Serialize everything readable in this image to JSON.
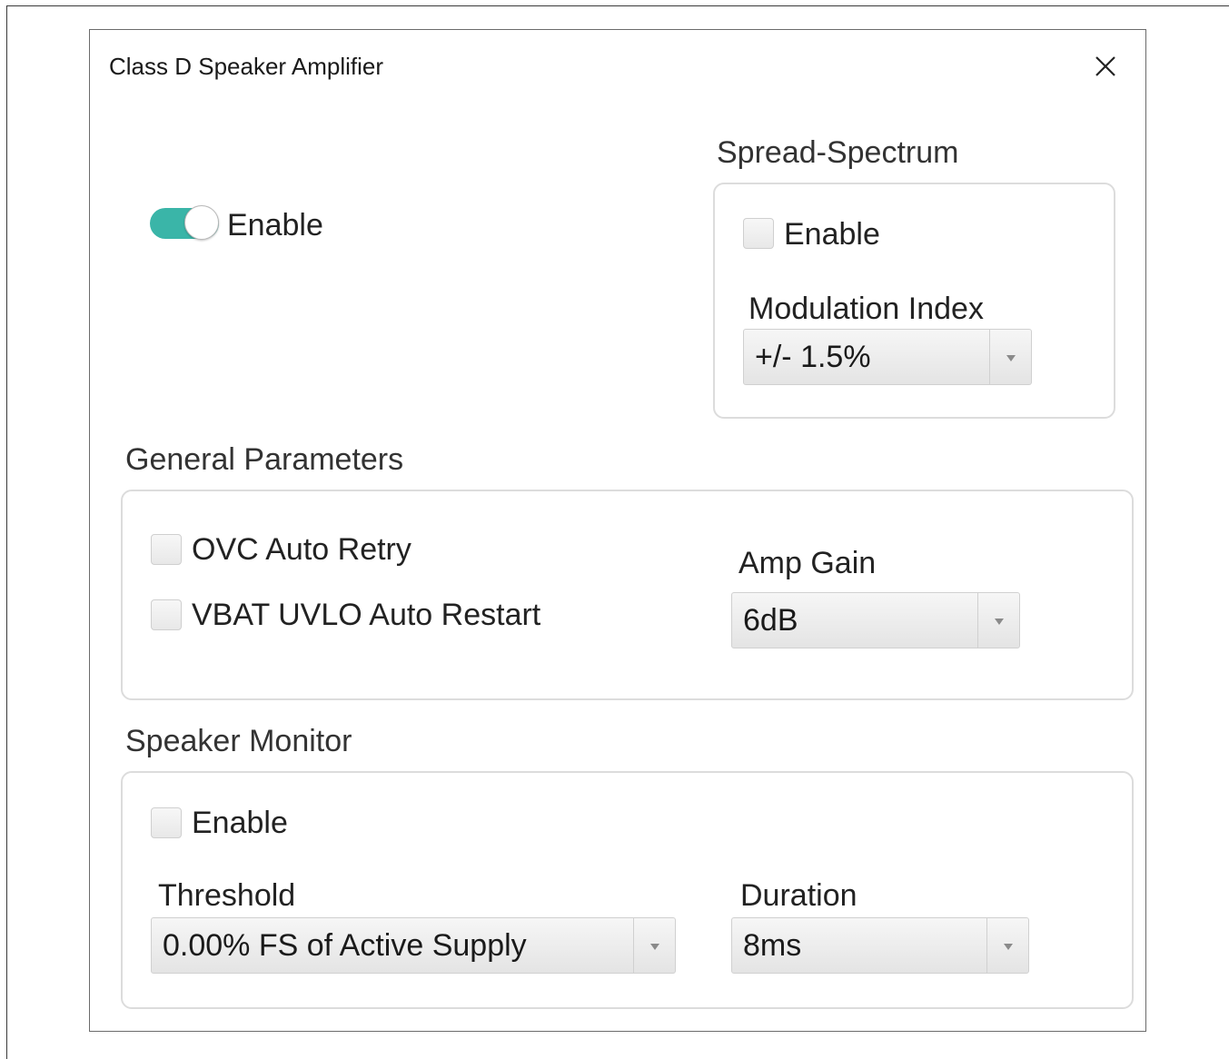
{
  "window": {
    "title": "Class D Speaker Amplifier",
    "close_icon": "close-icon"
  },
  "amplifier": {
    "enable_label": "Enable",
    "enabled": true,
    "accent_color": "#3ab5a8"
  },
  "spread_spectrum": {
    "title": "Spread-Spectrum",
    "enable_label": "Enable",
    "enabled": false,
    "modulation_index_label": "Modulation Index",
    "modulation_index_value": "+/- 1.5%"
  },
  "general_parameters": {
    "title": "General Parameters",
    "ovc_auto_retry_label": "OVC Auto Retry",
    "ovc_auto_retry": false,
    "vbat_uvlo_label": "VBAT UVLO Auto Restart",
    "vbat_uvlo": false,
    "amp_gain_label": "Amp Gain",
    "amp_gain_value": "6dB"
  },
  "speaker_monitor": {
    "title": "Speaker Monitor",
    "enable_label": "Enable",
    "enabled": false,
    "threshold_label": "Threshold",
    "threshold_value": "0.00% FS of Active Supply",
    "duration_label": "Duration",
    "duration_value": "8ms"
  }
}
